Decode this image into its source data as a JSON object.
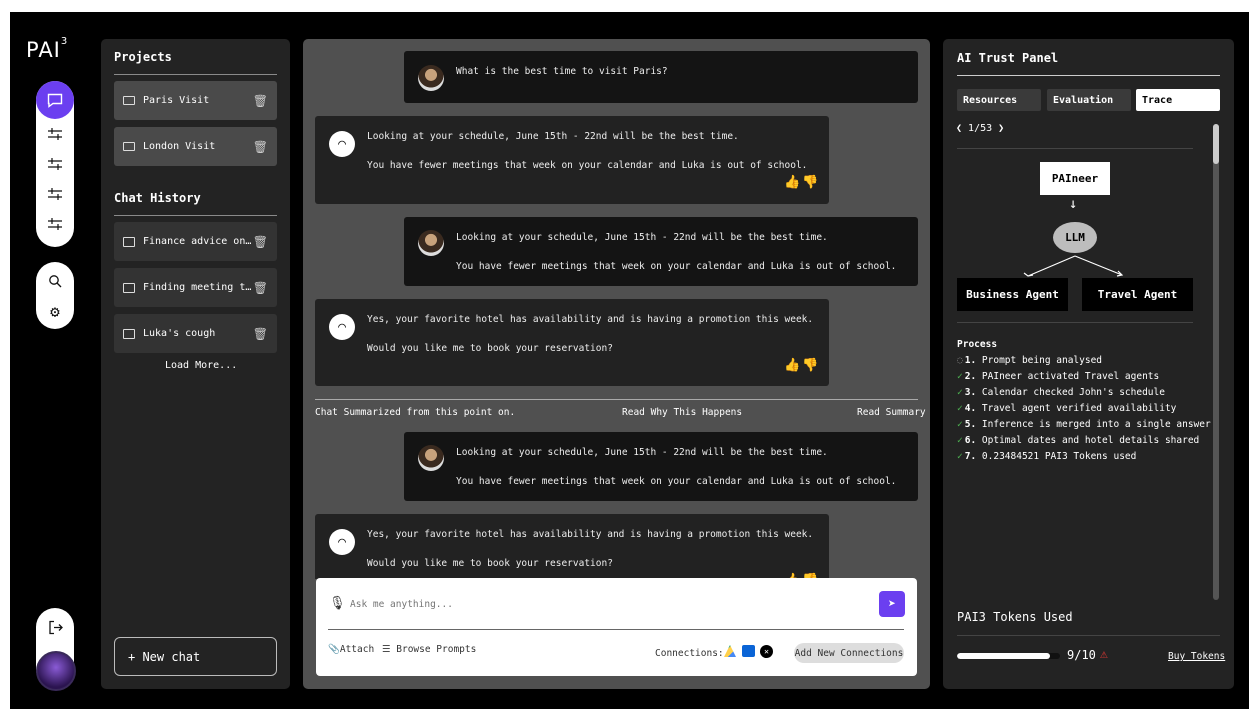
{
  "app": {
    "logo": "PAI",
    "logo_sup": "3"
  },
  "rail": {
    "icons": [
      "chat-icon",
      "sliders-icon",
      "sliders-icon",
      "sliders-icon",
      "sliders-icon",
      "search-icon",
      "gear-icon",
      "logout-icon"
    ]
  },
  "projects": {
    "title": "Projects",
    "items": [
      {
        "label": "Paris Visit"
      },
      {
        "label": "London Visit"
      }
    ]
  },
  "history": {
    "title": "Chat History",
    "items": [
      {
        "label": "Finance advice on fu…"
      },
      {
        "label": "Finding meeting time…"
      },
      {
        "label": "Luka's cough"
      }
    ],
    "load_more": "Load More..."
  },
  "new_chat": "+ New chat",
  "messages": [
    {
      "role": "user",
      "lines": [
        "What is the best time to visit Paris?"
      ]
    },
    {
      "role": "ai",
      "lines": [
        "Looking at your schedule, June 15th - 22nd will be the best time.",
        "You have fewer meetings that week on your calendar and Luka is out of school."
      ]
    },
    {
      "role": "user",
      "lines": [
        "Looking at your schedule, June 15th - 22nd will be the best time.",
        "You have fewer meetings that week on your calendar and Luka is out of school."
      ]
    },
    {
      "role": "ai",
      "lines": [
        "Yes, your favorite hotel has availability and is having a promotion this week.",
        "Would you like me to book your reservation?"
      ]
    },
    {
      "role": "user",
      "lines": [
        "Looking at your schedule, June 15th - 22nd will be the best time.",
        "You have fewer meetings that week on your calendar and Luka is out of school."
      ]
    },
    {
      "role": "ai",
      "lines": [
        "Yes, your favorite hotel has availability and is having a promotion this week.",
        "Would you like me to book your reservation?"
      ]
    }
  ],
  "summary": {
    "left": "Chat Summarized from this point on.",
    "middle": "Read Why This Happens",
    "right": "Read Summary"
  },
  "composer": {
    "placeholder": "Ask me anything...",
    "attach": "Attach",
    "browse": "Browse Prompts",
    "connections_label": "Connections:",
    "add_connections": "Add New Connections"
  },
  "trust": {
    "title": "AI Trust Panel",
    "tabs": [
      "Resources",
      "Evaluation",
      "Trace"
    ],
    "active_tab": "Trace",
    "pager": "1/53",
    "graph": {
      "root": "PAIneer",
      "mid": "LLM",
      "left": "Business Agent",
      "right": "Travel Agent"
    },
    "process_title": "Process",
    "process": [
      {
        "n": "1.",
        "text": "Prompt being analysed",
        "state": "pending"
      },
      {
        "n": "2.",
        "text": "PAIneer activated Travel agents",
        "state": "done"
      },
      {
        "n": "3.",
        "text": "Calendar checked John's schedule",
        "state": "done"
      },
      {
        "n": "4.",
        "text": "Travel agent verified availability",
        "state": "done"
      },
      {
        "n": "5.",
        "text": "Inference is merged into a single answer",
        "state": "done"
      },
      {
        "n": "6.",
        "text": "Optimal dates and hotel details shared",
        "state": "done"
      },
      {
        "n": "7.",
        "text": "0.23484521 PAI3 Tokens used",
        "state": "done"
      }
    ],
    "tokens_title": "PAI3 Tokens Used",
    "tokens_value": "9/10",
    "tokens_progress": 0.9,
    "buy": "Buy Tokens"
  },
  "colors": {
    "accent": "#6b3ff0",
    "check": "#4caf50",
    "warning": "#e53935"
  }
}
